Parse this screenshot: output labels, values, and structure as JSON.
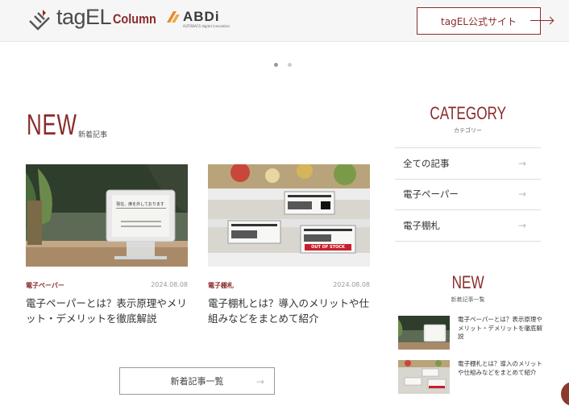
{
  "header": {
    "logo_text": "tagEL",
    "logo_column": "Column",
    "abdi_logo": "ABDi",
    "abdi_sub": "AUTOBACS digital innovation",
    "site_button": "tagEL公式サイト"
  },
  "carousel": {
    "pages": 2,
    "active": 0
  },
  "new_section": {
    "title": "NEW",
    "subtitle": "新着記事",
    "articles": [
      {
        "category": "電子ペーパー",
        "date": "2024.08.08",
        "title": "電子ペーパーとは？表示原理やメリット・デメリットを徹底解説",
        "image_text": "現在、席を外しております"
      },
      {
        "category": "電子棚札",
        "date": "2024.08.08",
        "title": "電子棚札とは？導入のメリットや仕組みなどをまとめて紹介",
        "image_text": "OUT OF STOCK"
      }
    ],
    "list_button": "新着記事一覧"
  },
  "sidebar": {
    "category_title": "CATEGORY",
    "category_subtitle": "カテゴリー",
    "categories": [
      "全ての記事",
      "電子ペーパー",
      "電子棚札"
    ],
    "new_title": "NEW",
    "new_subtitle": "新着記事一覧",
    "recent": [
      {
        "title": "電子ペーパーとは？表示原理やメリット・デメリットを徹底解説"
      },
      {
        "title": "電子棚札とは？導入のメリットや仕組みなどをまとめて紹介"
      }
    ]
  },
  "icons": {
    "arrow": "→"
  },
  "colors": {
    "accent": "#8b2b2b"
  }
}
